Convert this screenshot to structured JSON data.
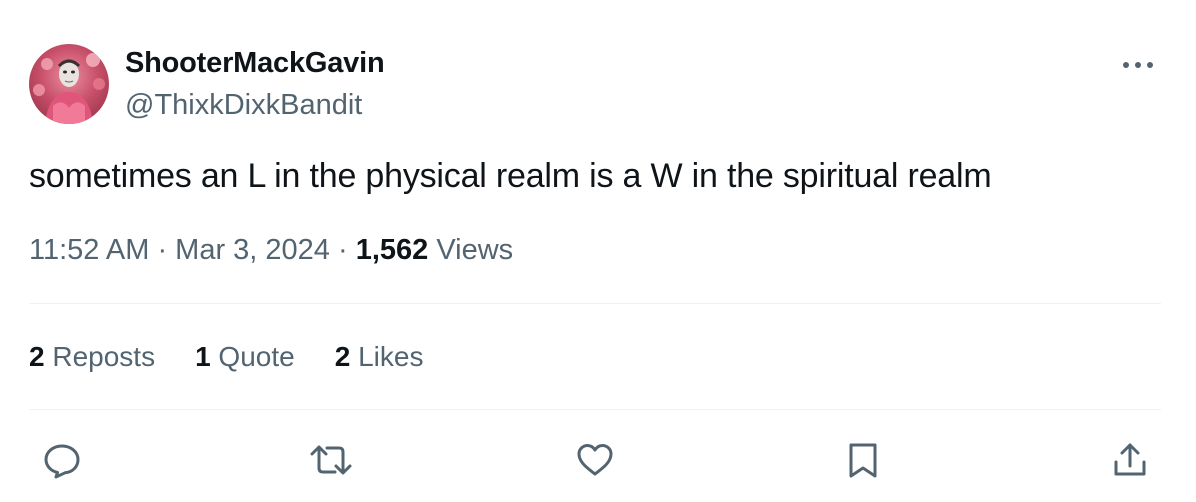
{
  "author": {
    "display_name": "ShooterMackGavin",
    "handle": "@ThixkDixkBandit"
  },
  "tweet": {
    "text": "sometimes an L in the physical realm is a W in the spiritual realm",
    "time": "11:52 AM",
    "separator": " · ",
    "date": "Mar 3, 2024",
    "views_count": "1,562",
    "views_label": " Views"
  },
  "stats": {
    "reposts_count": "2",
    "reposts_label": " Reposts",
    "quotes_count": "1",
    "quotes_label": " Quote",
    "likes_count": "2",
    "likes_label": " Likes"
  },
  "icons": {
    "more": "more-horizontal-icon",
    "reply": "reply-bubble-icon",
    "repost": "repost-arrows-icon",
    "like": "heart-icon",
    "bookmark": "bookmark-icon",
    "share": "share-upload-icon"
  },
  "colors": {
    "text_primary": "#0f1419",
    "text_secondary": "#536471",
    "divider": "#eff3f4"
  }
}
